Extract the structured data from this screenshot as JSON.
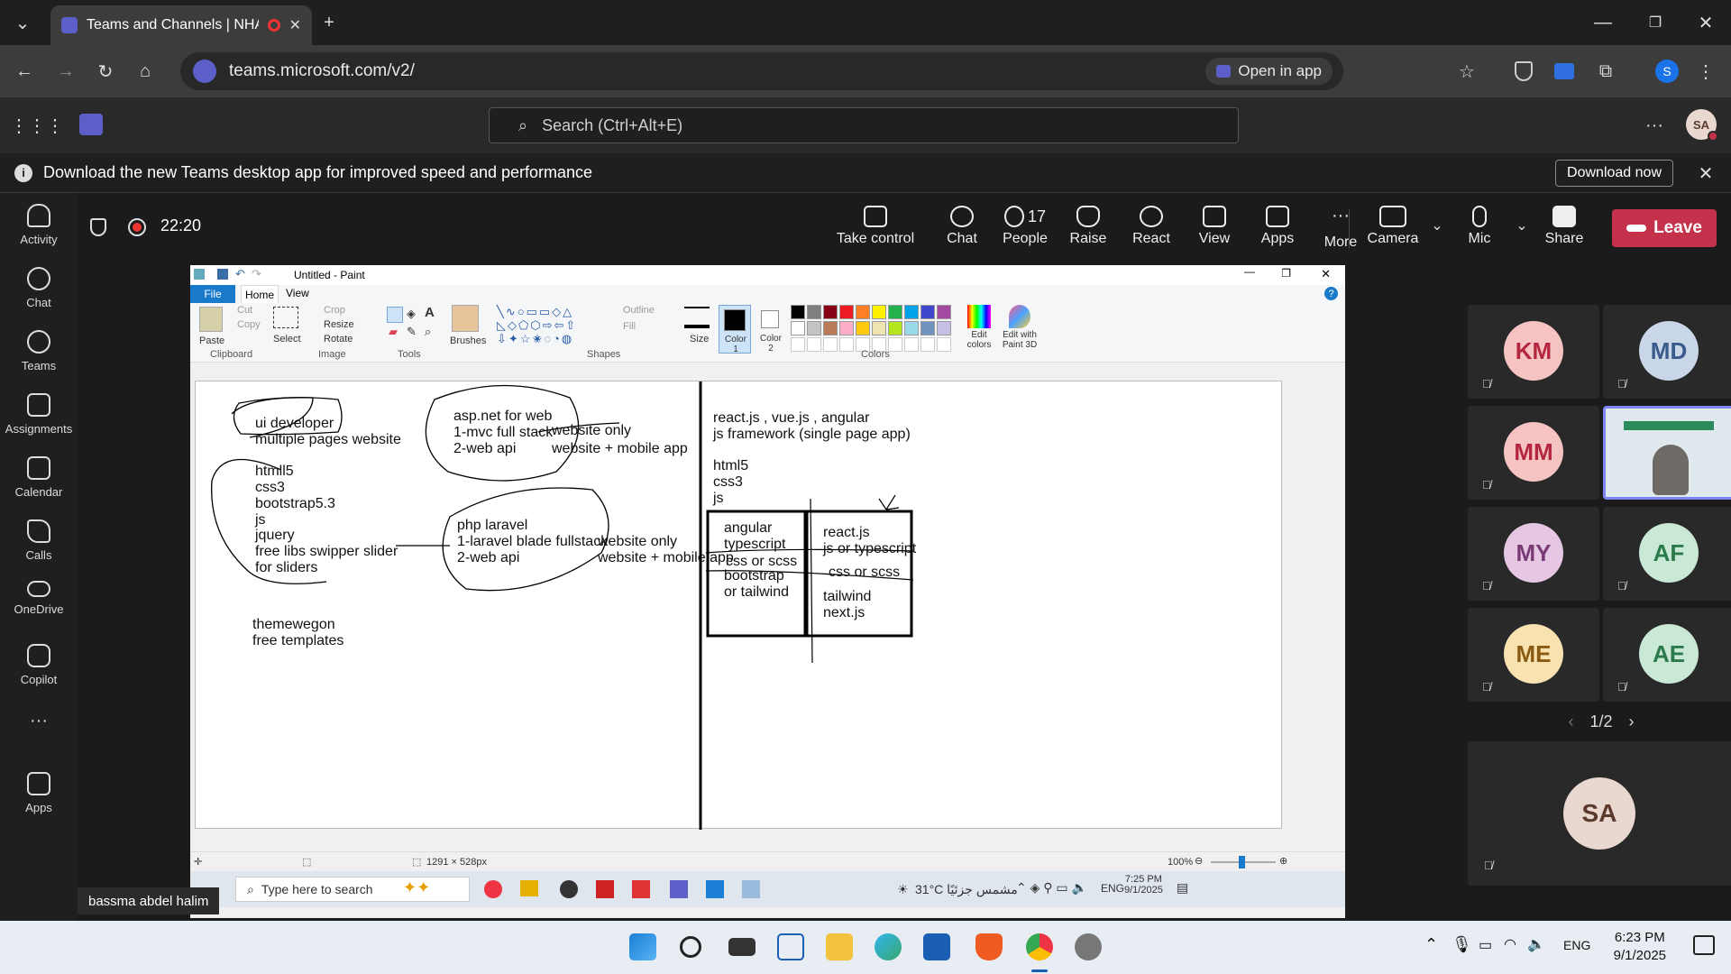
{
  "browser": {
    "tab_title": "Teams and Channels | NHA",
    "url": "teams.microsoft.com/v2/",
    "open_in_app": "Open in app",
    "profile_initial": "S"
  },
  "teams": {
    "search_placeholder": "Search (Ctrl+Alt+E)",
    "user_initials": "SA",
    "banner_text": "Download the new Teams desktop app for improved speed and performance",
    "download_now": "Download now",
    "rail": [
      {
        "label": "Activity",
        "icon": "bell-icon"
      },
      {
        "label": "Chat",
        "icon": "chat-icon"
      },
      {
        "label": "Teams",
        "icon": "teams-icon"
      },
      {
        "label": "Assignments",
        "icon": "backpack-icon"
      },
      {
        "label": "Calendar",
        "icon": "calendar-icon"
      },
      {
        "label": "Calls",
        "icon": "phone-icon"
      },
      {
        "label": "OneDrive",
        "icon": "cloud-icon"
      },
      {
        "label": "Copilot",
        "icon": "copilot-icon"
      },
      {
        "label": "Apps",
        "icon": "add-apps-icon"
      }
    ]
  },
  "meeting": {
    "timer": "22:20",
    "controls": {
      "take_control": "Take control",
      "chat": "Chat",
      "people": "People",
      "people_count": "17",
      "raise": "Raise",
      "react": "React",
      "view": "View",
      "apps": "Apps",
      "more": "More",
      "camera": "Camera",
      "mic": "Mic",
      "share": "Share",
      "leave": "Leave"
    },
    "presenter_name": "bassma abdel halim",
    "participants": [
      {
        "initials": "KM",
        "color": "#f6c3c3",
        "fg": "#b3263d"
      },
      {
        "initials": "MD",
        "color": "#c9d6e8",
        "fg": "#3a5a8c"
      },
      {
        "initials": "MM",
        "color": "#f6c3c3",
        "fg": "#b3263d"
      },
      {
        "initials": "",
        "color": "#9ab"
      },
      {
        "initials": "MY",
        "color": "#e6c7e3",
        "fg": "#7a3a76"
      },
      {
        "initials": "AF",
        "color": "#c9e8d6",
        "fg": "#2b7a4b"
      },
      {
        "initials": "ME",
        "color": "#f7e2b0",
        "fg": "#8a5a12"
      },
      {
        "initials": "AE",
        "color": "#c9e8d6",
        "fg": "#2b7a4b"
      }
    ],
    "page_indicator": "1/2",
    "self_initials": "SA"
  },
  "paint": {
    "title": "Untitled - Paint",
    "tabs": [
      "File",
      "Home",
      "View"
    ],
    "groups": {
      "clipboard": "Clipboard",
      "image": "Image",
      "tools": "Tools",
      "shapes": "Shapes",
      "colors": "Colors"
    },
    "buttons": {
      "paste": "Paste",
      "cut": "Cut",
      "copy": "Copy",
      "select": "Select",
      "crop": "Crop",
      "resize": "Resize",
      "rotate": "Rotate",
      "brushes": "Brushes",
      "outline": "Outline",
      "fill": "Fill",
      "size": "Size",
      "color1": "Color 1",
      "color2": "Color 2",
      "edit_colors": "Edit colors",
      "edit_paint3d": "Edit with Paint 3D"
    },
    "palette": [
      "#000000",
      "#7f7f7f",
      "#880015",
      "#ed1c24",
      "#ff7f27",
      "#fff200",
      "#22b14c",
      "#00a2e8",
      "#3f48cc",
      "#a349a4",
      "#ffffff",
      "#c3c3c3",
      "#b97a57",
      "#ffaec9",
      "#ffc90e",
      "#efe4b0",
      "#b5e61d",
      "#99d9ea",
      "#7092be",
      "#c8bfe7"
    ],
    "canvas_text": {
      "a1": "ui developer",
      "a2": "multiple pages website",
      "b1": "htmll5",
      "b2": "css3",
      "b3": "bootstrap5.3",
      "b4": "js",
      "b5": "jquery",
      "b6": "free libs swipper slider",
      "b7": "for sliders",
      "c1": "themewegon",
      "c2": "free templates",
      "d1": "asp.net for web",
      "d2": "1-mvc full stack",
      "d3": "2-web api",
      "d4": "website only",
      "d5": "website + mobile app",
      "e1": "php laravel",
      "e2": "1-laravel blade fullstack",
      "e3": "2-web api",
      "e4": "website only",
      "e5": "website + mobile app",
      "f1": "react.js , vue.js , angular",
      "f2": "js framework (single page app)",
      "f3": "html5",
      "f4": "css3",
      "f5": "js",
      "g1": "angular",
      "g2": "typescript",
      "g3": "css or scss",
      "g4": "bootstrap",
      "g5": "or tailwind",
      "h1": "react.js",
      "h2": "js  or typescript",
      "h3": "css or scss",
      "h4": "tailwind",
      "h5": "next.js"
    },
    "status_size": "1291 × 528px",
    "zoom": "100%"
  },
  "inner_taskbar": {
    "search": "Type here to search",
    "weather": "31°C  مشمس جزئيًا",
    "lang": "ENG",
    "time": "7:25 PM",
    "date": "9/1/2025"
  },
  "windows": {
    "lang": "ENG",
    "time": "6:23 PM",
    "date": "9/1/2025"
  }
}
